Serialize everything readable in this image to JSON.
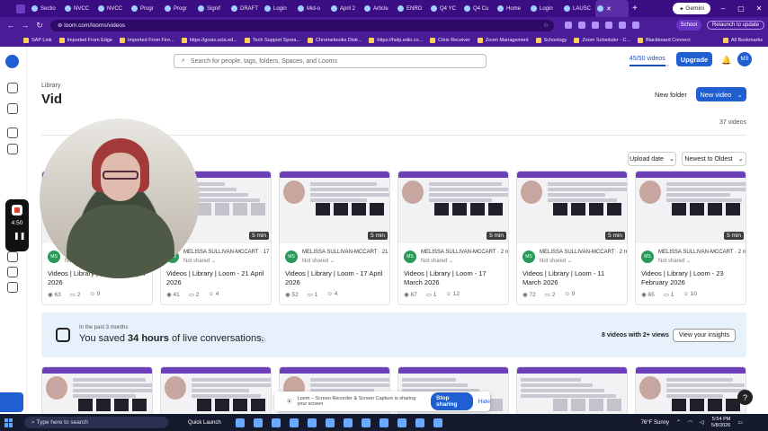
{
  "browser": {
    "tabs": [
      "Sectio",
      "NVCC",
      "NVCC",
      "Progr",
      "Progr",
      "Signif",
      "DRAFT",
      "Login",
      "Mid-o",
      "April 2",
      "Article",
      "ENRO",
      "Q4 YC",
      "Q4 Cu",
      "Home",
      "Login",
      "LAUSC"
    ],
    "gemini_label": "Gemini",
    "url": "loom.com/looms/videos",
    "profile_label": "School",
    "relaunch_label": "Relaunch to update",
    "bookmarks": [
      "SAP Link",
      "Imported From Edge",
      "Imported From Fire...",
      "https://gosis.ucla.ed...",
      "Tech Support Sprea...",
      "Chromebooks Distr...",
      "https://help.edio.co...",
      "Citrix Receiver",
      "Zoom Management",
      "Schoology",
      "Zoom Scheduler - C...",
      "Blackboard Connect"
    ],
    "all_bookmarks_label": "All Bookmarks"
  },
  "header": {
    "search_placeholder": "Search for people, tags, folders, Spaces, and Looms",
    "quota_label": "45/50 videos",
    "quota_fraction": 0.9,
    "upgrade_label": "Upgrade",
    "avatar_initials": "MS"
  },
  "page": {
    "breadcrumb": "Library",
    "title": "Vid",
    "new_folder_label": "New folder",
    "new_video_label": "New video",
    "video_count": "37 videos",
    "sort_filter_label": "Upload date",
    "sort_order_label": "Newest to Oldest"
  },
  "videos": [
    {
      "duration": "5 min",
      "author": "MELISSA SULLIVAN-MCCART",
      "age": "11 d",
      "shared": "Not shared",
      "title": "Videos | Library | Loom - 27 April 2026",
      "views": "63",
      "comments": "2",
      "reactions": "9",
      "initials": "MS"
    },
    {
      "duration": "5 min",
      "author": "MELISSA SULLIVAN-MCCART",
      "age": "17 d",
      "shared": "Not shared",
      "title": "Videos | Library | Loom - 21 April 2026",
      "views": "41",
      "comments": "2",
      "reactions": "4",
      "initials": "MS"
    },
    {
      "duration": "5 min",
      "author": "MELISSA SULLIVAN-MCCART",
      "age": "21 d",
      "shared": "Not shared",
      "title": "Videos | Library | Loom - 17 April 2026",
      "views": "52",
      "comments": "1",
      "reactions": "4",
      "initials": "MS"
    },
    {
      "duration": "5 min",
      "author": "MELISSA SULLIVAN-MCCART",
      "age": "2 m",
      "shared": "Not shared",
      "title": "Videos | Library | Loom - 17 March 2026",
      "views": "67",
      "comments": "1",
      "reactions": "12",
      "initials": "MS"
    },
    {
      "duration": "5 min",
      "author": "MELISSA SULLIVAN-MCCART",
      "age": "2 m",
      "shared": "Not shared",
      "title": "Videos | Library | Loom - 11 March 2026",
      "views": "72",
      "comments": "2",
      "reactions": "9",
      "initials": "MS"
    },
    {
      "duration": "5 min",
      "author": "MELISSA SULLIVAN-MCCART",
      "age": "2 m",
      "shared": "Not shared",
      "title": "Videos | Library | Loom - 23 February 2026",
      "views": "65",
      "comments": "1",
      "reactions": "10",
      "initials": "MS"
    }
  ],
  "banner": {
    "subtitle": "In the past 3 months",
    "text_prefix": "You saved ",
    "text_bold": "34 hours",
    "text_suffix": " of live conversations.",
    "info_icon": "info-icon",
    "count_label": "8 videos with 2+ views",
    "insights_label": "View your insights"
  },
  "recorder": {
    "time": "4:50",
    "share_text": "Loom – Screen Recorder & Screen Capture is sharing your screen.",
    "stop_label": "Stop sharing",
    "hide_label": "Hide"
  },
  "taskbar": {
    "search_placeholder": "Type here to search",
    "quick_launch_label": "Quick Launch",
    "weather": "76°F Sunny",
    "time": "5:54 PM",
    "date": "5/8/2026"
  },
  "colors": {
    "accent": "#1f5fd1",
    "browser_frame": "#4b1c97",
    "banner_bg": "#e6f1fc"
  }
}
